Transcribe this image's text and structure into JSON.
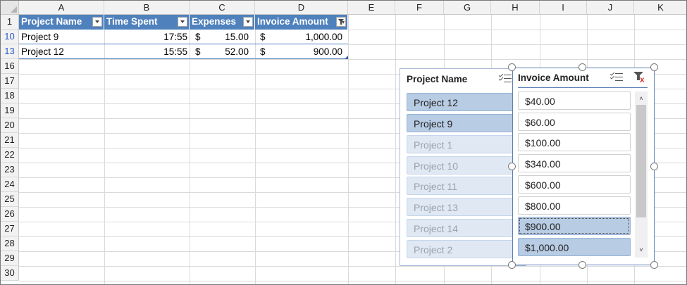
{
  "columns": [
    "A",
    "B",
    "C",
    "D",
    "E",
    "F",
    "G",
    "H",
    "I",
    "J",
    "K"
  ],
  "rows": [
    {
      "num": "1",
      "filtered": false
    },
    {
      "num": "10",
      "filtered": true
    },
    {
      "num": "13",
      "filtered": true
    },
    {
      "num": "16",
      "filtered": false
    },
    {
      "num": "17",
      "filtered": false
    },
    {
      "num": "18",
      "filtered": false
    },
    {
      "num": "19",
      "filtered": false
    },
    {
      "num": "20",
      "filtered": false
    },
    {
      "num": "21",
      "filtered": false
    },
    {
      "num": "22",
      "filtered": false
    },
    {
      "num": "23",
      "filtered": false
    },
    {
      "num": "24",
      "filtered": false
    },
    {
      "num": "25",
      "filtered": false
    },
    {
      "num": "26",
      "filtered": false
    },
    {
      "num": "27",
      "filtered": false
    },
    {
      "num": "28",
      "filtered": false
    },
    {
      "num": "29",
      "filtered": false
    },
    {
      "num": "30",
      "filtered": false
    }
  ],
  "table": {
    "headers": [
      "Project Name",
      "Time Spent",
      "Expenses",
      "Invoice Amount"
    ],
    "filtered_column": "Invoice Amount",
    "data": [
      {
        "project": "Project 9",
        "time": "17:55",
        "exp_cur": "$",
        "exp_val": "15.00",
        "inv_cur": "$",
        "inv_val": "1,000.00"
      },
      {
        "project": "Project 12",
        "time": "15:55",
        "exp_cur": "$",
        "exp_val": "52.00",
        "inv_cur": "$",
        "inv_val": "900.00"
      }
    ]
  },
  "slicer_project": {
    "title": "Project Name",
    "items": [
      {
        "label": "Project 12",
        "state": "selected"
      },
      {
        "label": "Project 9",
        "state": "selected"
      },
      {
        "label": "Project 1",
        "state": "no-data"
      },
      {
        "label": "Project 10",
        "state": "no-data"
      },
      {
        "label": "Project 11",
        "state": "no-data"
      },
      {
        "label": "Project 13",
        "state": "no-data"
      },
      {
        "label": "Project 14",
        "state": "no-data"
      },
      {
        "label": "Project 2",
        "state": "no-data"
      }
    ]
  },
  "slicer_invoice": {
    "title": "Invoice Amount",
    "items": [
      {
        "label": "$40.00",
        "state": "unselected"
      },
      {
        "label": "$60.00",
        "state": "unselected"
      },
      {
        "label": "$100.00",
        "state": "unselected"
      },
      {
        "label": "$340.00",
        "state": "unselected"
      },
      {
        "label": "$600.00",
        "state": "unselected"
      },
      {
        "label": "$800.00",
        "state": "unselected"
      },
      {
        "label": "$900.00",
        "state": "selected"
      },
      {
        "label": "$1,000.00",
        "state": "selected"
      }
    ],
    "scroll_up_glyph": "˄",
    "scroll_down_glyph": "˅"
  },
  "icons": {
    "multi_select": "multi-select-icon",
    "clear_filter": "clear-filter-icon",
    "header_dropdown": "dropdown-arrow-icon",
    "header_filter": "filter-applied-icon"
  },
  "colors": {
    "table_header": "#4f81bd",
    "slicer_selected": "#b8cce4",
    "slicer_no_data": "#dfe8f3",
    "row_filtered_number": "#2b57c4"
  }
}
